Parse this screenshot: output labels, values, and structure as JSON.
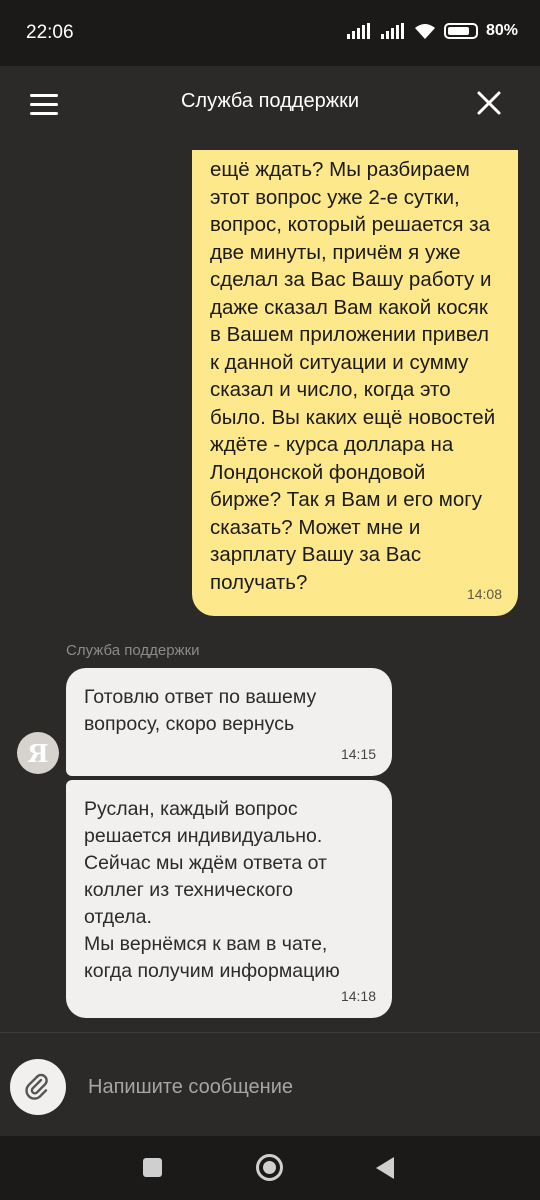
{
  "status_bar": {
    "time": "22:06",
    "battery": "80%",
    "battery_level": 0.8
  },
  "header": {
    "title": "Служба поддержки"
  },
  "messages": {
    "outgoing": {
      "text": "ещё ждать? Мы разбираем\nэтот вопрос уже 2-е сутки,\nвопрос, который решается за\nдве минуты, причём я уже\nсделал за Вас Вашу работу и\nдаже сказал Вам какой косяк\nв Вашем приложении привел\nк данной ситуации и сумму\nсказал и число, когда это\nбыло. Вы каких ещё новостей\nждёте - курса доллара на\nЛондонской фондовой\nбирже? Так я Вам и его могу\nсказать? Может мне и\nзарплату Вашу за Вас\nполучать?",
      "time": "14:08"
    },
    "sender_name": "Служба поддержки",
    "avatar_letter": "Я",
    "incoming": [
      {
        "text": "Готовлю ответ по вашему\nвопросу, скоро вернусь",
        "time": "14:15"
      },
      {
        "text": "Руслан, каждый вопрос\nрешается индивидуально.\nСейчас мы ждём ответа от\nколлег из технического\nотдела.\nМы вернёмся к вам в чате,\nкогда получим информацию",
        "time": "14:18"
      }
    ]
  },
  "composer": {
    "placeholder": "Напишите сообщение"
  },
  "colors": {
    "outgoing_bubble": "#fde88c",
    "incoming_bubble": "#f1f0ee",
    "background": "#2b2a29"
  }
}
